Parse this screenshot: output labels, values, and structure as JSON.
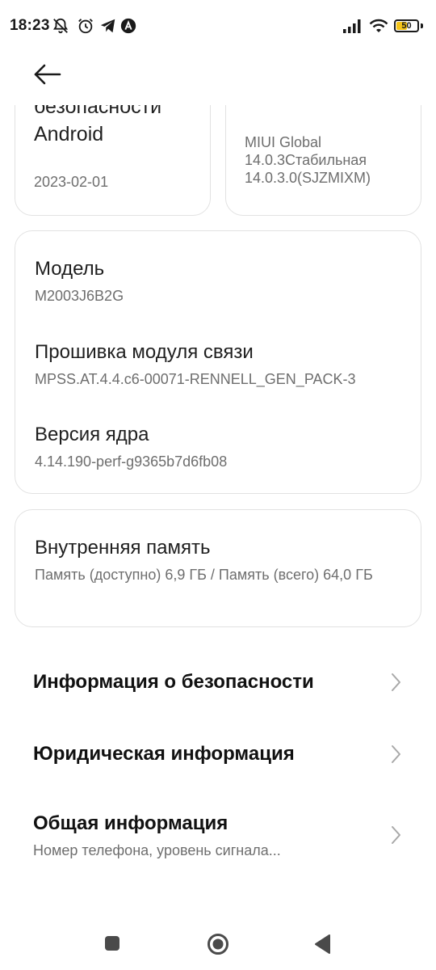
{
  "status_bar": {
    "time": "18:23",
    "battery_level": "50",
    "icons": [
      "notifications-off-icon",
      "alarm-icon",
      "telegram-icon",
      "vpn-icon",
      "signal-icon",
      "wifi-icon",
      "battery-icon"
    ]
  },
  "header": {
    "back_icon": "arrow-left-icon"
  },
  "top_cards": {
    "security": {
      "title_line1": "безопасности",
      "title_line2": "Android",
      "date": "2023-02-01"
    },
    "miui": {
      "lines": [
        "MIUI Global",
        "14.0.3Стабильная",
        "14.0.3.0(SJZMIXM)"
      ]
    }
  },
  "device_info": {
    "model_label": "Модель",
    "model_value": "M2003J6B2G",
    "baseband_label": "Прошивка модуля связи",
    "baseband_value": "MPSS.AT.4.4.c6-00071-RENNELL_GEN_PACK-3",
    "kernel_label": "Версия ядра",
    "kernel_value": "4.14.190-perf-g9365b7d6fb08"
  },
  "storage": {
    "label": "Внутренняя память",
    "value": "Память (доступно)  6,9 ГБ / Память (всего) 64,0 ГБ"
  },
  "menu": [
    {
      "title": "Информация о безопасности",
      "subtitle": ""
    },
    {
      "title": "Юридическая информация",
      "subtitle": ""
    },
    {
      "title": "Общая информация",
      "subtitle": "Номер телефона, уровень сигнала..."
    }
  ],
  "nav_bar": {
    "icons": [
      "recents-square-icon",
      "home-circle-icon",
      "back-triangle-icon"
    ]
  },
  "colors": {
    "battery_fill": "#f5c518",
    "card_border": "#e2e2e2",
    "secondary_text": "#6e6e6e"
  }
}
